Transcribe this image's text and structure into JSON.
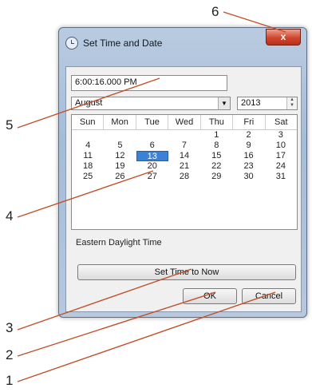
{
  "callouts": [
    "1",
    "2",
    "3",
    "4",
    "5",
    "6"
  ],
  "window": {
    "title": "Set Time and Date",
    "close_glyph": "x"
  },
  "time_field": {
    "value": "6:00:16.000 PM"
  },
  "month_select": {
    "value": "August"
  },
  "year_spin": {
    "value": "2013"
  },
  "calendar": {
    "weekdays": [
      "Sun",
      "Mon",
      "Tue",
      "Wed",
      "Thu",
      "Fri",
      "Sat"
    ],
    "days": [
      "",
      "",
      "",
      "",
      "1",
      "2",
      "3",
      "4",
      "5",
      "6",
      "7",
      "8",
      "9",
      "10",
      "11",
      "12",
      "13",
      "14",
      "15",
      "16",
      "17",
      "18",
      "19",
      "20",
      "21",
      "22",
      "23",
      "24",
      "25",
      "26",
      "27",
      "28",
      "29",
      "30",
      "31"
    ],
    "selected_day": "13"
  },
  "timezone_label": "Eastern Daylight Time",
  "buttons": {
    "set_now": "Set Time to Now",
    "ok": "OK",
    "cancel": "Cancel"
  },
  "colors": {
    "selected_day_bg": "#3b82d6",
    "close_button": "#d0452c"
  }
}
